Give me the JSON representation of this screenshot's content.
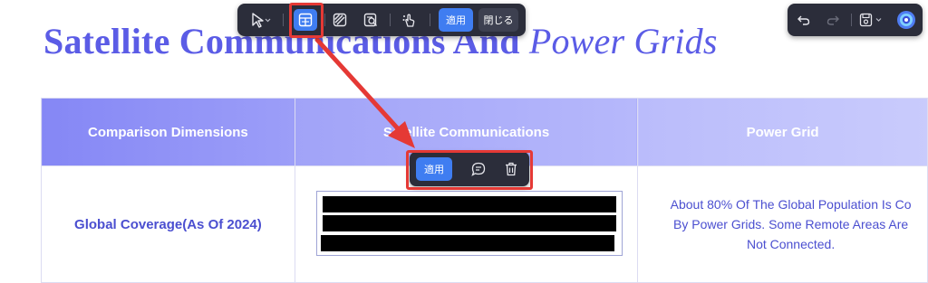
{
  "document": {
    "title_bold": "Satellite Communications And ",
    "title_italic": "Power Grids"
  },
  "table": {
    "headers": [
      "Comparison Dimensions",
      "Satellite Communications",
      "Power Grid"
    ],
    "row_label": "Global Coverage(As Of 2024)",
    "power_grid_lines": [
      "About 80% Of The Global Population Is Co",
      "By Power Grids. Some Remote Areas Are",
      "Not Connected."
    ]
  },
  "toolbar": {
    "apply_label": "適用",
    "close_label": "閉じる",
    "tools": [
      "cursor-select-icon",
      "table-recognition-icon",
      "pattern-fill-icon",
      "ocr-text-icon",
      "touch-icon"
    ]
  },
  "right_toolbar": {
    "tools": [
      "undo-icon",
      "redo-icon",
      "save-icon",
      "assistant-icon"
    ]
  },
  "float_toolbar": {
    "apply_label": "適用",
    "tools": [
      "comment-icon",
      "delete-icon"
    ]
  },
  "colors": {
    "accent": "#3f7df1",
    "title": "#5b5ce6",
    "highlight": "#e53935",
    "toolbar_bg": "#2b2d3a"
  }
}
